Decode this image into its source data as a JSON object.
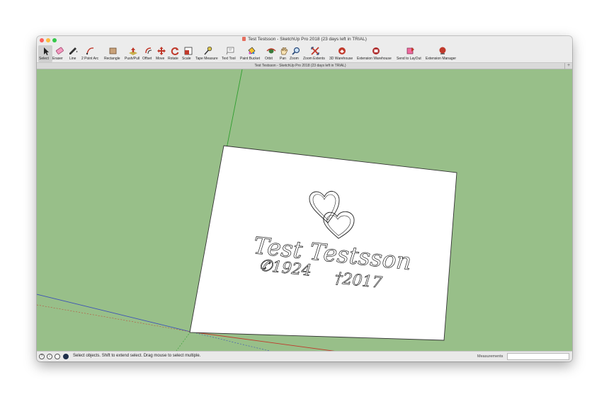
{
  "window": {
    "title": "Test Testsson - SketchUp Pro 2018 (23 days left in TRIAL)",
    "document_tab": "Test Testsson - SketchUp Pro 2018 (23 days left in TRIAL)"
  },
  "toolbar": {
    "tools": [
      {
        "id": "select",
        "label": "Select",
        "icon": "arrow-cursor-icon"
      },
      {
        "id": "eraser",
        "label": "Eraser",
        "icon": "eraser-icon"
      },
      {
        "id": "line",
        "label": "Line",
        "icon": "pencil-icon"
      },
      {
        "id": "arc",
        "label": "2 Point Arc",
        "icon": "arc-icon"
      },
      {
        "id": "rectangle",
        "label": "Rectangle",
        "icon": "rectangle-icon"
      },
      {
        "id": "pushpull",
        "label": "Push/Pull",
        "icon": "push-pull-icon"
      },
      {
        "id": "offset",
        "label": "Offset",
        "icon": "offset-icon"
      },
      {
        "id": "move",
        "label": "Move",
        "icon": "move-arrows-icon"
      },
      {
        "id": "rotate",
        "label": "Rotate",
        "icon": "rotate-icon"
      },
      {
        "id": "scale",
        "label": "Scale",
        "icon": "scale-icon"
      },
      {
        "id": "tape",
        "label": "Tape Measure",
        "icon": "tape-measure-icon"
      },
      {
        "id": "text",
        "label": "Text Tool",
        "icon": "text-tool-icon"
      },
      {
        "id": "paint",
        "label": "Paint Bucket",
        "icon": "paint-bucket-icon"
      },
      {
        "id": "orbit",
        "label": "Orbit",
        "icon": "orbit-icon"
      },
      {
        "id": "pan",
        "label": "Pan",
        "icon": "pan-hand-icon"
      },
      {
        "id": "zoom",
        "label": "Zoom",
        "icon": "magnifier-icon"
      },
      {
        "id": "zoom-extents",
        "label": "Zoom Extents",
        "icon": "zoom-extents-icon"
      },
      {
        "id": "warehouse",
        "label": "3D Warehouse",
        "icon": "warehouse-icon"
      },
      {
        "id": "ext-warehouse",
        "label": "Extension Warehouse",
        "icon": "extension-warehouse-icon"
      },
      {
        "id": "layout",
        "label": "Send to LayOut",
        "icon": "layout-icon"
      },
      {
        "id": "ext-manager",
        "label": "Extension Manager",
        "icon": "extension-manager-icon"
      }
    ]
  },
  "model": {
    "name_text": "Test Testsson",
    "birth_text": "✆1924",
    "death_text": "†2017"
  },
  "status": {
    "message": "Select objects. Shift to extend select. Drag mouse to select multiple.",
    "measurements_label": "Measurements",
    "measurements_value": ""
  },
  "colors": {
    "viewport_bg": "#98bf89",
    "red_axis": "#c0392b",
    "green_axis": "#2f9e2f",
    "blue_axis": "#3a4fb8"
  }
}
